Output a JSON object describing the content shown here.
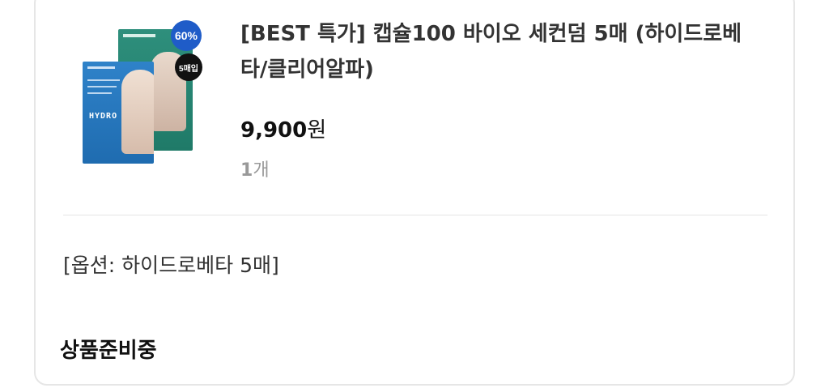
{
  "product": {
    "title": "[BEST 특가] 캡슐100 바이오 세컨덤 5매 (하이드로베타/클리어알파)",
    "discount_badge": "60%",
    "count_badge": "5매입",
    "image_label": "HYDRO",
    "price": "9,900",
    "price_unit": "원",
    "quantity": "1",
    "quantity_unit": "개",
    "option": "[옵션: 하이드로베타 5매]",
    "status": "상품준비중"
  },
  "colors": {
    "discount_badge": "#1f5cc8",
    "count_badge": "#111111",
    "divider": "#e4e4e4",
    "card_border": "#e6e6e6"
  }
}
